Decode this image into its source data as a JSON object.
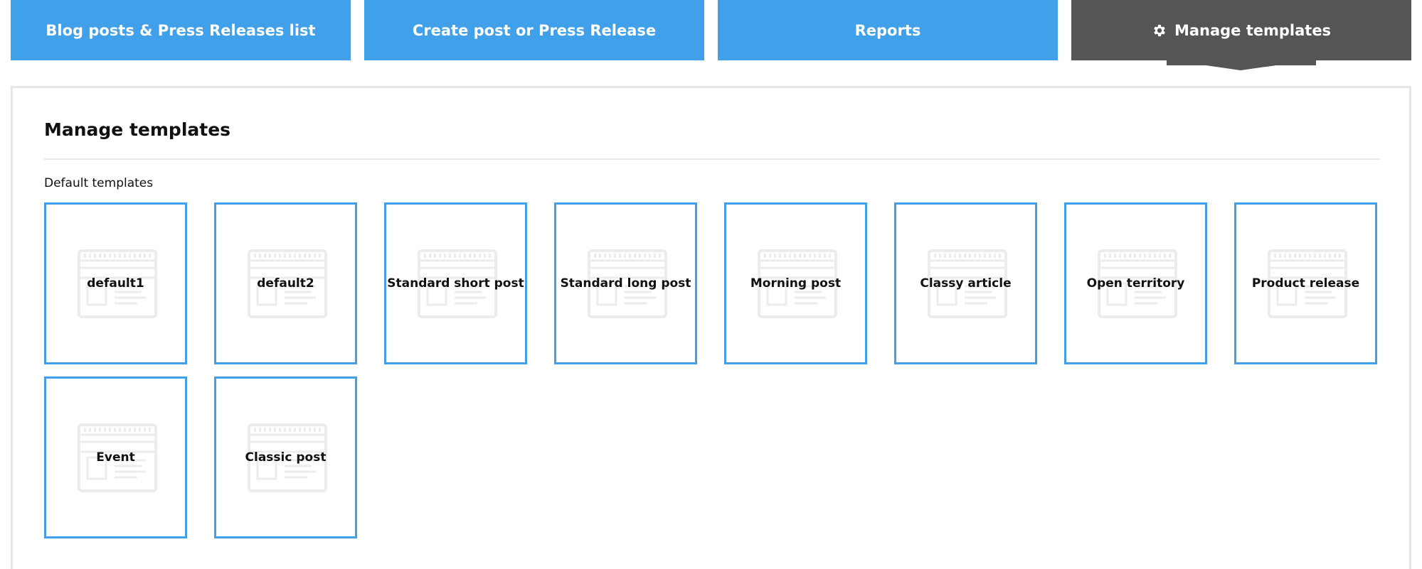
{
  "tabs": [
    {
      "label": "Blog posts & Press Releases list",
      "active": false
    },
    {
      "label": "Create post or Press Release",
      "active": false
    },
    {
      "label": "Reports",
      "active": false
    },
    {
      "label": "Manage templates",
      "active": true,
      "icon": "gear-icon"
    }
  ],
  "main": {
    "title": "Manage templates",
    "section_label": "Default templates",
    "templates": [
      {
        "label": "default1",
        "icon": "template-placeholder-icon"
      },
      {
        "label": "default2",
        "icon": "template-placeholder-icon"
      },
      {
        "label": "Standard short post",
        "icon": "template-placeholder-icon"
      },
      {
        "label": "Standard long post",
        "icon": "template-placeholder-icon"
      },
      {
        "label": "Morning post",
        "icon": "template-placeholder-icon"
      },
      {
        "label": "Classy article",
        "icon": "template-placeholder-icon"
      },
      {
        "label": "Open territory",
        "icon": "template-placeholder-icon"
      },
      {
        "label": "Product release",
        "icon": "template-placeholder-icon"
      },
      {
        "label": "Event",
        "icon": "template-placeholder-icon"
      },
      {
        "label": "Classic post",
        "icon": "template-placeholder-icon"
      }
    ]
  },
  "colors": {
    "tab_blue": "#40a1ea",
    "tab_active": "#555555",
    "card_border": "#40a1ea",
    "panel_border": "#e6e6e6"
  }
}
